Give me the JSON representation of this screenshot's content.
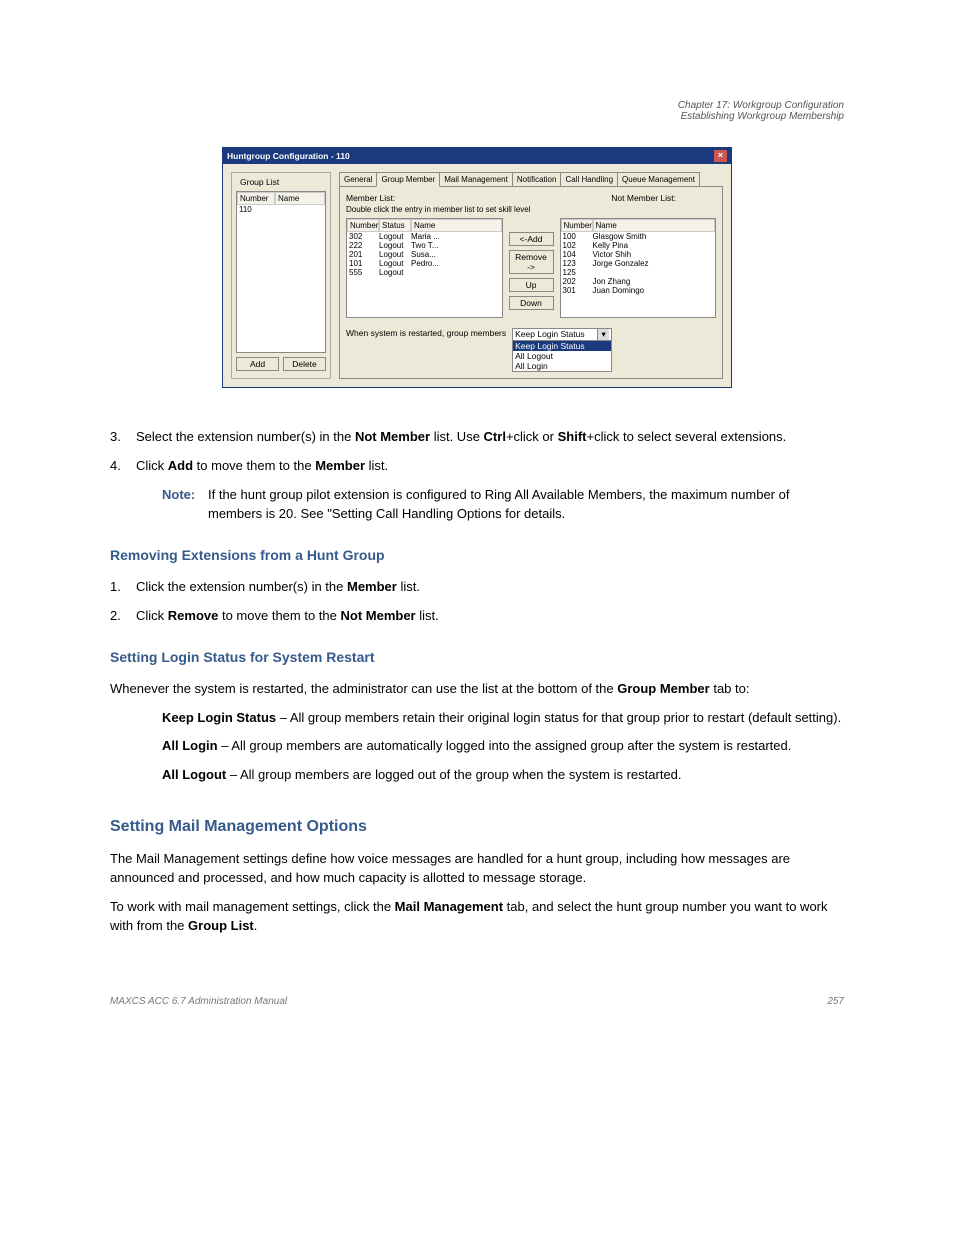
{
  "header": {
    "right1": "Chapter 17: Workgroup Configuration",
    "right2": "Establishing Workgroup Membership"
  },
  "win": {
    "title": "Huntgroup Configuration - 110",
    "close": "×",
    "grouplist_label": "Group List",
    "gl_col_number": "Number",
    "gl_col_name": "Name",
    "gl_rows": [
      [
        "110",
        ""
      ]
    ],
    "gl_add": "Add",
    "gl_delete": "Delete",
    "tabs": [
      "General",
      "Group Member",
      "Mail Management",
      "Notification",
      "Call Handling",
      "Queue Management"
    ],
    "active_tab": 1,
    "member_list_label": "Member List:",
    "member_hint": "Double click the entry in member list to set skill level",
    "not_member_list_label": "Not Member List:",
    "mem_col_number": "Number",
    "mem_col_status": "Status",
    "mem_col_name": "Name",
    "members": [
      [
        "302",
        "Logout",
        "Maria ..."
      ],
      [
        "222",
        "Logout",
        "Two T..."
      ],
      [
        "201",
        "Logout",
        "Susa..."
      ],
      [
        "101",
        "Logout",
        "Pedro..."
      ],
      [
        "555",
        "Logout",
        ""
      ]
    ],
    "nm_col_number": "Number",
    "nm_col_name": "Name",
    "not_members": [
      [
        "100",
        "Glasgow Smith"
      ],
      [
        "102",
        "Kelly Pina"
      ],
      [
        "104",
        "Victor Shih"
      ],
      [
        "123",
        "Jorge Gonzalez"
      ],
      [
        "125",
        ""
      ],
      [
        "202",
        "Jon Zhang"
      ],
      [
        "301",
        "Juan Domingo"
      ]
    ],
    "btn_add": "<-Add",
    "btn_remove": "Remove ->",
    "btn_up": "Up",
    "btn_down": "Down",
    "restart_label": "When system is restarted, group members",
    "dd_selected": "Keep Login Status",
    "dd_options": [
      "Keep Login Status",
      "All Logout",
      "All Login"
    ]
  },
  "text": {
    "step3_num": "3.",
    "step3_a": "Select the extension number(s) in the ",
    "step3_b_bold": "Not Member",
    "step3_c": " list. Use ",
    "step3_d_bold": "Ctrl",
    "step3_e": "+click or ",
    "step3_f_bold": "Shift",
    "step3_g": "+click to select several extensions.",
    "step4_num": "4.",
    "step4_a": "Click ",
    "step4_b_bold": "Add",
    "step4_c": " to move them to the ",
    "step4_d_bold": "Member",
    "step4_e": " list.",
    "note_label": "Note:",
    "note_text": "If the hunt group pilot extension is configured to Ring All Available Members, the maximum number of members is 20. See \"Setting Call Handling Options for details.",
    "subhead1": "Removing Extensions from a Hunt Group",
    "r1_num": "1.",
    "r1_a": "Click the extension number(s) in the ",
    "r1_b_bold": "Member",
    "r1_c": " list.",
    "r2_num": "2.",
    "r2_a": "Click ",
    "r2_b_bold": "Remove",
    "r2_c": " to move them to the ",
    "r2_d_bold": "Not Member",
    "r2_e": " list.",
    "subhead2": "Setting Login Status for System Restart",
    "p2_a": "Whenever the system is restarted, the administrator can use the list at the bottom of the ",
    "p2_b_bold": "Group Member",
    "p2_c": " tab to:",
    "b1_bold": "Keep Login Status",
    "b1_rest": " – All group members retain their original login status for that group prior to restart (default setting).",
    "b2_bold": "All Login",
    "b2_rest": " – All group members are automatically logged into the assigned group after the system is restarted.",
    "b3_bold": "All Logout",
    "b3_rest": " – All group members are logged out of the group when the system is restarted.",
    "h2": "Setting Mail Management Options",
    "mm_p1": "The Mail Management settings define how voice messages are handled for a hunt group, including how messages are announced and processed, and how much capacity is allotted to message storage.",
    "mm_p2_a": "To work with mail management settings, click the ",
    "mm_p2_b_bold": "Mail Management",
    "mm_p2_c": " tab, and select the hunt group number you want to work with from the ",
    "mm_p2_d_bold": "Group List",
    "mm_p2_e": "."
  },
  "footer": {
    "left": "MAXCS ACC 6.7 Administration Manual",
    "right": "257"
  }
}
